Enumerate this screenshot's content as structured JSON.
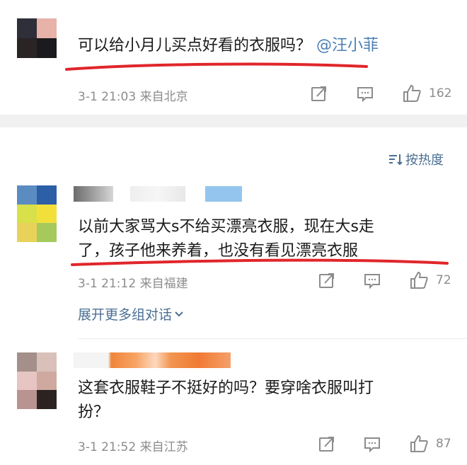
{
  "comments": [
    {
      "text": "可以给小月儿买点好看的衣服吗？",
      "mention": "@汪小菲",
      "time": "3-1 21:03",
      "location": "来自北京",
      "likes": "162"
    },
    {
      "text_line1": "以前大家骂大s不给买漂亮衣服，现在大s走",
      "text_line2": "了，孩子他来养着，也没有看见漂亮衣服",
      "time": "3-1 21:12",
      "location": "来自福建",
      "likes": "72",
      "expand_label": "展开更多组对话"
    },
    {
      "text_line1": "这套衣服鞋子不挺好的吗？要穿啥衣服叫打",
      "text_line2": "扮？",
      "time": "3-1 21:52",
      "location": "来自江苏",
      "likes": "87"
    }
  ],
  "sort_label": "按热度",
  "icons": [
    "share-icon",
    "comment-icon",
    "like-icon",
    "sort-icon",
    "chevron-down-icon"
  ],
  "colors": {
    "underline": "#e0262b",
    "link": "#4a7fb5",
    "meta": "#8c8c8c"
  }
}
